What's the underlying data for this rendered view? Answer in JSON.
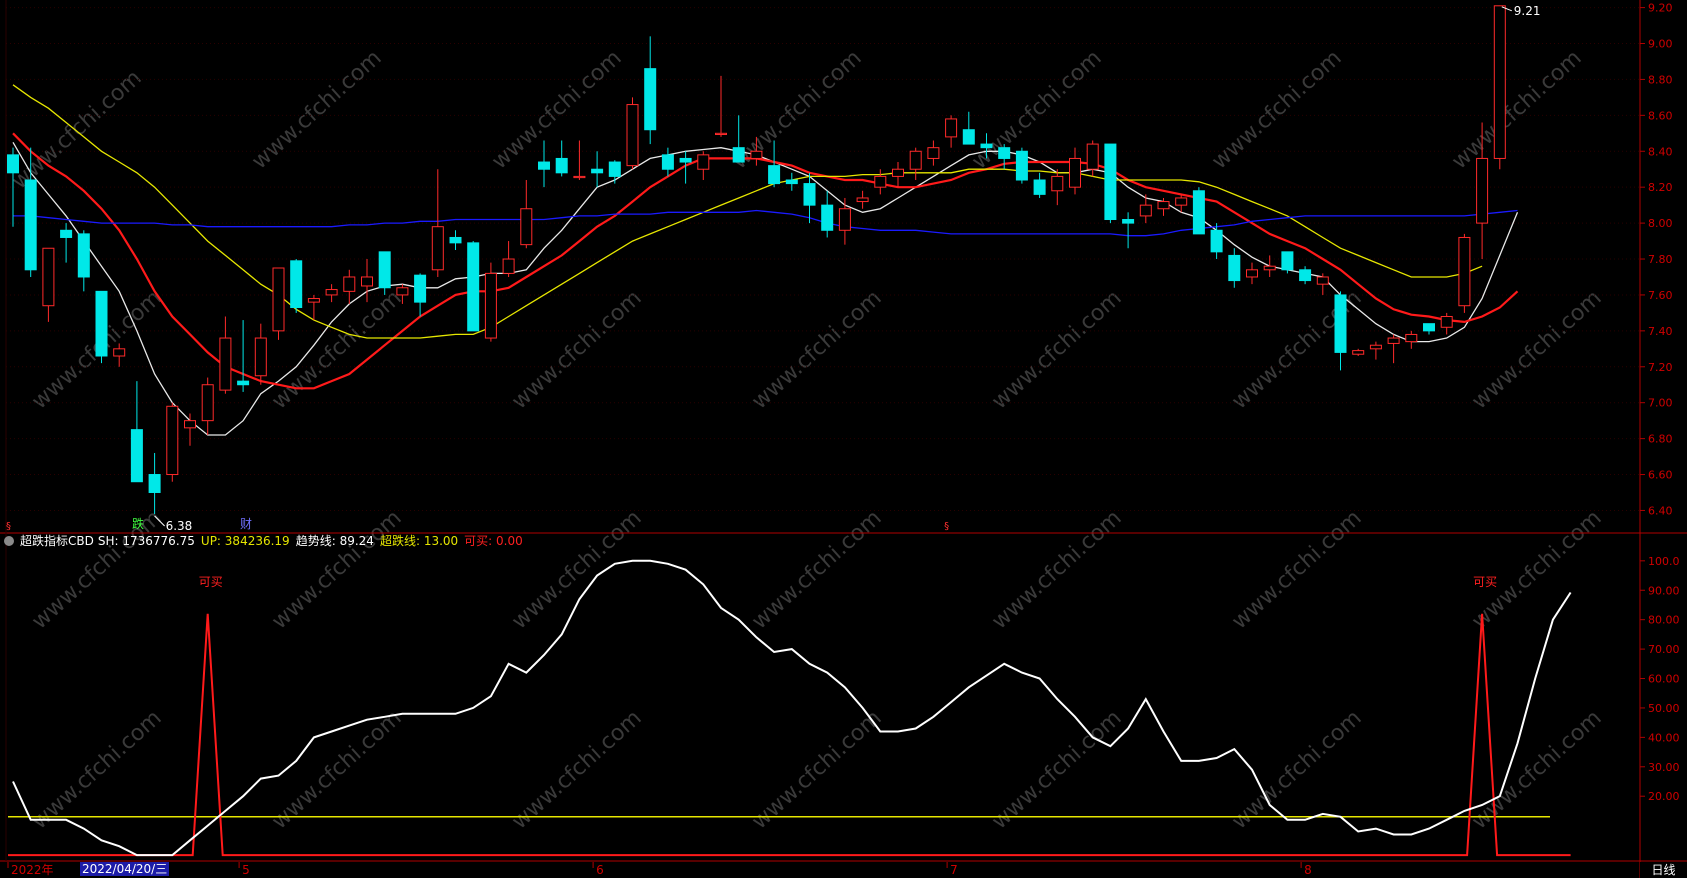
{
  "chart_data": {
    "type": "candlestick",
    "price_axis": {
      "ticks": [
        "9.20",
        "9.00",
        "8.80",
        "8.60",
        "8.40",
        "8.20",
        "8.00",
        "7.80",
        "7.60",
        "7.40",
        "7.20",
        "7.00",
        "6.80",
        "6.60",
        "6.40"
      ],
      "ylim": [
        6.28,
        9.22
      ]
    },
    "candles": [
      {
        "o": 8.38,
        "h": 8.42,
        "l": 7.98,
        "c": 8.28
      },
      {
        "o": 8.24,
        "h": 8.42,
        "l": 7.7,
        "c": 7.74
      },
      {
        "o": 7.54,
        "h": 7.86,
        "l": 7.45,
        "c": 7.86
      },
      {
        "o": 7.96,
        "h": 8.0,
        "l": 7.78,
        "c": 7.92
      },
      {
        "o": 7.94,
        "h": 7.96,
        "l": 7.62,
        "c": 7.7
      },
      {
        "o": 7.62,
        "h": 7.62,
        "l": 7.22,
        "c": 7.26
      },
      {
        "o": 7.26,
        "h": 7.33,
        "l": 7.2,
        "c": 7.3
      },
      {
        "o": 6.85,
        "h": 7.12,
        "l": 6.58,
        "c": 6.56
      },
      {
        "o": 6.6,
        "h": 6.72,
        "l": 6.38,
        "c": 6.5
      },
      {
        "o": 6.6,
        "h": 7.0,
        "l": 6.56,
        "c": 6.98
      },
      {
        "o": 6.86,
        "h": 6.94,
        "l": 6.76,
        "c": 6.9
      },
      {
        "o": 6.9,
        "h": 7.14,
        "l": 6.82,
        "c": 7.1
      },
      {
        "o": 7.07,
        "h": 7.48,
        "l": 7.05,
        "c": 7.36
      },
      {
        "o": 7.12,
        "h": 7.46,
        "l": 7.06,
        "c": 7.1
      },
      {
        "o": 7.15,
        "h": 7.44,
        "l": 7.1,
        "c": 7.36
      },
      {
        "o": 7.4,
        "h": 7.7,
        "l": 7.35,
        "c": 7.75
      },
      {
        "o": 7.79,
        "h": 7.8,
        "l": 7.5,
        "c": 7.53
      },
      {
        "o": 7.56,
        "h": 7.6,
        "l": 7.46,
        "c": 7.58
      },
      {
        "o": 7.6,
        "h": 7.66,
        "l": 7.56,
        "c": 7.63
      },
      {
        "o": 7.62,
        "h": 7.74,
        "l": 7.55,
        "c": 7.7
      },
      {
        "o": 7.65,
        "h": 7.8,
        "l": 7.56,
        "c": 7.7
      },
      {
        "o": 7.84,
        "h": 7.84,
        "l": 7.6,
        "c": 7.64
      },
      {
        "o": 7.6,
        "h": 7.66,
        "l": 7.55,
        "c": 7.64
      },
      {
        "o": 7.71,
        "h": 7.72,
        "l": 7.48,
        "c": 7.56
      },
      {
        "o": 7.74,
        "h": 8.3,
        "l": 7.7,
        "c": 7.98
      },
      {
        "o": 7.92,
        "h": 7.96,
        "l": 7.85,
        "c": 7.89
      },
      {
        "o": 7.89,
        "h": 7.9,
        "l": 7.4,
        "c": 7.4
      },
      {
        "o": 7.36,
        "h": 7.78,
        "l": 7.34,
        "c": 7.72
      },
      {
        "o": 7.72,
        "h": 7.9,
        "l": 7.7,
        "c": 7.8
      },
      {
        "o": 7.88,
        "h": 8.24,
        "l": 7.86,
        "c": 8.08
      },
      {
        "o": 8.34,
        "h": 8.46,
        "l": 8.2,
        "c": 8.3
      },
      {
        "o": 8.36,
        "h": 8.46,
        "l": 8.26,
        "c": 8.28
      },
      {
        "o": 8.26,
        "h": 8.46,
        "l": 8.24,
        "c": 8.26
      },
      {
        "o": 8.3,
        "h": 8.4,
        "l": 8.2,
        "c": 8.28
      },
      {
        "o": 8.34,
        "h": 8.35,
        "l": 8.22,
        "c": 8.26
      },
      {
        "o": 8.32,
        "h": 8.7,
        "l": 8.3,
        "c": 8.66
      },
      {
        "o": 8.86,
        "h": 9.04,
        "l": 8.44,
        "c": 8.52
      },
      {
        "o": 8.38,
        "h": 8.42,
        "l": 8.26,
        "c": 8.3
      },
      {
        "o": 8.36,
        "h": 8.4,
        "l": 8.22,
        "c": 8.34
      },
      {
        "o": 8.3,
        "h": 8.4,
        "l": 8.24,
        "c": 8.38
      },
      {
        "o": 8.5,
        "h": 8.82,
        "l": 8.48,
        "c": 8.5
      },
      {
        "o": 8.42,
        "h": 8.6,
        "l": 8.36,
        "c": 8.34
      },
      {
        "o": 8.36,
        "h": 8.48,
        "l": 8.32,
        "c": 8.4
      },
      {
        "o": 8.32,
        "h": 8.46,
        "l": 8.2,
        "c": 8.22
      },
      {
        "o": 8.24,
        "h": 8.28,
        "l": 8.18,
        "c": 8.22
      },
      {
        "o": 8.22,
        "h": 8.28,
        "l": 8.0,
        "c": 8.1
      },
      {
        "o": 8.1,
        "h": 8.18,
        "l": 7.92,
        "c": 7.96
      },
      {
        "o": 7.96,
        "h": 8.14,
        "l": 7.88,
        "c": 8.08
      },
      {
        "o": 8.12,
        "h": 8.18,
        "l": 8.08,
        "c": 8.14
      },
      {
        "o": 8.2,
        "h": 8.3,
        "l": 8.16,
        "c": 8.26
      },
      {
        "o": 8.26,
        "h": 8.34,
        "l": 8.2,
        "c": 8.3
      },
      {
        "o": 8.3,
        "h": 8.42,
        "l": 8.24,
        "c": 8.4
      },
      {
        "o": 8.36,
        "h": 8.46,
        "l": 8.32,
        "c": 8.42
      },
      {
        "o": 8.48,
        "h": 8.6,
        "l": 8.42,
        "c": 8.58
      },
      {
        "o": 8.52,
        "h": 8.62,
        "l": 8.46,
        "c": 8.44
      },
      {
        "o": 8.44,
        "h": 8.5,
        "l": 8.36,
        "c": 8.42
      },
      {
        "o": 8.42,
        "h": 8.44,
        "l": 8.3,
        "c": 8.36
      },
      {
        "o": 8.4,
        "h": 8.42,
        "l": 8.22,
        "c": 8.24
      },
      {
        "o": 8.24,
        "h": 8.28,
        "l": 8.14,
        "c": 8.16
      },
      {
        "o": 8.18,
        "h": 8.3,
        "l": 8.1,
        "c": 8.26
      },
      {
        "o": 8.2,
        "h": 8.42,
        "l": 8.16,
        "c": 8.36
      },
      {
        "o": 8.3,
        "h": 8.46,
        "l": 8.26,
        "c": 8.44
      },
      {
        "o": 8.44,
        "h": 8.44,
        "l": 8.0,
        "c": 8.02
      },
      {
        "o": 8.02,
        "h": 8.06,
        "l": 7.86,
        "c": 8.0
      },
      {
        "o": 8.04,
        "h": 8.16,
        "l": 8.0,
        "c": 8.1
      },
      {
        "o": 8.08,
        "h": 8.14,
        "l": 8.04,
        "c": 8.12
      },
      {
        "o": 8.1,
        "h": 8.16,
        "l": 8.06,
        "c": 8.14
      },
      {
        "o": 8.18,
        "h": 8.2,
        "l": 7.94,
        "c": 7.94
      },
      {
        "o": 7.96,
        "h": 8.0,
        "l": 7.8,
        "c": 7.84
      },
      {
        "o": 7.82,
        "h": 7.86,
        "l": 7.64,
        "c": 7.68
      },
      {
        "o": 7.7,
        "h": 7.78,
        "l": 7.66,
        "c": 7.74
      },
      {
        "o": 7.74,
        "h": 7.82,
        "l": 7.7,
        "c": 7.76
      },
      {
        "o": 7.84,
        "h": 7.84,
        "l": 7.72,
        "c": 7.74
      },
      {
        "o": 7.74,
        "h": 7.76,
        "l": 7.66,
        "c": 7.68
      },
      {
        "o": 7.66,
        "h": 7.72,
        "l": 7.6,
        "c": 7.7
      },
      {
        "o": 7.6,
        "h": 7.62,
        "l": 7.18,
        "c": 7.28
      },
      {
        "o": 7.27,
        "h": 7.3,
        "l": 7.26,
        "c": 7.29
      },
      {
        "o": 7.3,
        "h": 7.34,
        "l": 7.24,
        "c": 7.32
      },
      {
        "o": 7.33,
        "h": 7.38,
        "l": 7.22,
        "c": 7.36
      },
      {
        "o": 7.34,
        "h": 7.4,
        "l": 7.3,
        "c": 7.38
      },
      {
        "o": 7.44,
        "h": 7.44,
        "l": 7.38,
        "c": 7.4
      },
      {
        "o": 7.42,
        "h": 7.5,
        "l": 7.38,
        "c": 7.48
      },
      {
        "o": 7.54,
        "h": 7.94,
        "l": 7.5,
        "c": 7.92
      },
      {
        "o": 8.0,
        "h": 8.56,
        "l": 7.8,
        "c": 8.36
      },
      {
        "o": 8.36,
        "h": 9.21,
        "l": 8.3,
        "c": 9.21
      }
    ],
    "ma": [
      {
        "name": "MA5",
        "color": "#e8e8e8",
        "values": [
          8.45,
          8.28,
          8.16,
          8.04,
          7.9,
          7.76,
          7.62,
          7.4,
          7.16,
          7.0,
          6.9,
          6.82,
          6.82,
          6.9,
          7.05,
          7.12,
          7.2,
          7.32,
          7.45,
          7.55,
          7.62,
          7.65,
          7.66,
          7.64,
          7.64,
          7.69,
          7.7,
          7.72,
          7.72,
          7.74,
          7.86,
          7.96,
          8.08,
          8.2,
          8.24,
          8.3,
          8.36,
          8.38,
          8.4,
          8.41,
          8.42,
          8.4,
          8.38,
          8.34,
          8.3,
          8.26,
          8.18,
          8.1,
          8.06,
          8.08,
          8.14,
          8.2,
          8.26,
          8.32,
          8.38,
          8.4,
          8.4,
          8.38,
          8.34,
          8.28,
          8.28,
          8.3,
          8.28,
          8.2,
          8.14,
          8.12,
          8.06,
          8.03,
          7.96,
          7.88,
          7.81,
          7.76,
          7.74,
          7.72,
          7.7,
          7.6,
          7.52,
          7.44,
          7.38,
          7.34,
          7.34,
          7.36,
          7.42,
          7.58,
          7.82,
          8.06
        ]
      },
      {
        "name": "MA10",
        "color": "#ff1a1a",
        "values": [
          8.5,
          8.4,
          8.32,
          8.26,
          8.18,
          8.08,
          7.96,
          7.8,
          7.62,
          7.48,
          7.38,
          7.28,
          7.2,
          7.16,
          7.12,
          7.1,
          7.08,
          7.08,
          7.12,
          7.16,
          7.24,
          7.32,
          7.4,
          7.48,
          7.54,
          7.6,
          7.62,
          7.62,
          7.64,
          7.7,
          7.76,
          7.82,
          7.9,
          7.98,
          8.04,
          8.12,
          8.2,
          8.26,
          8.32,
          8.36,
          8.36,
          8.36,
          8.36,
          8.34,
          8.32,
          8.28,
          8.26,
          8.24,
          8.24,
          8.22,
          8.2,
          8.2,
          8.22,
          8.24,
          8.28,
          8.3,
          8.33,
          8.34,
          8.34,
          8.34,
          8.34,
          8.33,
          8.3,
          8.24,
          8.2,
          8.18,
          8.16,
          8.14,
          8.12,
          8.06,
          8.0,
          7.94,
          7.9,
          7.86,
          7.8,
          7.74,
          7.66,
          7.58,
          7.52,
          7.49,
          7.48,
          7.46,
          7.45,
          7.48,
          7.53,
          7.62
        ]
      },
      {
        "name": "MA20",
        "color": "#e6e600",
        "values": [
          8.77,
          8.7,
          8.64,
          8.56,
          8.48,
          8.4,
          8.34,
          8.28,
          8.2,
          8.1,
          8.0,
          7.9,
          7.82,
          7.74,
          7.66,
          7.6,
          7.52,
          7.46,
          7.42,
          7.38,
          7.36,
          7.36,
          7.36,
          7.36,
          7.37,
          7.38,
          7.38,
          7.42,
          7.48,
          7.54,
          7.6,
          7.66,
          7.72,
          7.78,
          7.84,
          7.9,
          7.94,
          7.98,
          8.02,
          8.06,
          8.1,
          8.14,
          8.18,
          8.22,
          8.24,
          8.26,
          8.26,
          8.26,
          8.27,
          8.27,
          8.28,
          8.28,
          8.28,
          8.28,
          8.3,
          8.3,
          8.3,
          8.29,
          8.29,
          8.28,
          8.28,
          8.26,
          8.24,
          8.24,
          8.24,
          8.24,
          8.24,
          8.23,
          8.2,
          8.16,
          8.12,
          8.08,
          8.04,
          7.98,
          7.92,
          7.86,
          7.82,
          7.78,
          7.74,
          7.7,
          7.7,
          7.7,
          7.72,
          7.76
        ]
      },
      {
        "name": "MA60",
        "color": "#1a1aff",
        "values": [
          8.04,
          8.04,
          8.03,
          8.02,
          8.01,
          8.0,
          8.0,
          8.0,
          8.0,
          7.99,
          7.99,
          7.98,
          7.98,
          7.98,
          7.98,
          7.98,
          7.98,
          7.98,
          7.98,
          7.99,
          7.99,
          8.0,
          8.0,
          8.01,
          8.01,
          8.02,
          8.02,
          8.02,
          8.02,
          8.02,
          8.02,
          8.03,
          8.04,
          8.04,
          8.05,
          8.05,
          8.05,
          8.06,
          8.06,
          8.06,
          8.06,
          8.06,
          8.07,
          8.06,
          8.05,
          8.03,
          8.0,
          7.98,
          7.97,
          7.96,
          7.96,
          7.96,
          7.95,
          7.94,
          7.94,
          7.94,
          7.94,
          7.94,
          7.94,
          7.94,
          7.94,
          7.94,
          7.94,
          7.93,
          7.93,
          7.94,
          7.96,
          7.97,
          7.98,
          7.99,
          8.01,
          8.02,
          8.03,
          8.04,
          8.04,
          8.04,
          8.04,
          8.04,
          8.04,
          8.04,
          8.04,
          8.04,
          8.04,
          8.05,
          8.06,
          8.07
        ]
      }
    ],
    "price_markers": {
      "low_label": "6.38",
      "high_label": "9.21"
    },
    "event_labels": {
      "die": "跌",
      "cai": "财"
    },
    "indicator": {
      "name": "超跌指标CBD",
      "sh_label": "SH:",
      "sh_value": "1736776.75",
      "up_label": "UP:",
      "up_value": "384236.19",
      "trend_label": "趋势线:",
      "trend_value": "89.24",
      "oversold_label": "超跌线:",
      "oversold_value": "13.00",
      "buy_label": "可买:",
      "buy_value": "0.00",
      "axis_ticks": [
        "100.0",
        "90.00",
        "80.00",
        "70.00",
        "60.00",
        "50.00",
        "40.00",
        "30.00",
        "20.00"
      ],
      "ylim": [
        -1,
        103
      ],
      "oversold_level": 13,
      "trend_values": [
        25,
        12,
        12,
        12,
        9,
        5,
        3,
        0,
        0,
        0,
        5,
        10,
        15,
        20,
        26,
        27,
        32,
        40,
        42,
        44,
        46,
        47,
        48,
        48,
        48,
        48,
        50,
        54,
        65,
        62,
        68,
        75,
        87,
        95,
        99,
        100,
        100,
        99,
        97,
        92,
        84,
        80,
        74,
        69,
        70,
        65,
        62,
        57,
        50,
        42,
        42,
        43,
        47,
        52,
        57,
        61,
        65,
        62,
        60,
        53,
        47,
        40,
        37,
        43,
        53,
        42,
        32,
        32,
        33,
        36,
        29,
        17,
        12,
        12,
        14,
        13,
        8,
        9,
        7,
        7,
        9,
        12,
        15,
        17,
        20,
        38,
        60,
        80,
        89.24
      ],
      "buy_signal": {
        "label": "可买",
        "indices": [
          11,
          83
        ],
        "high": 82
      }
    },
    "time_axis": {
      "labels": [
        "2022年",
        "5",
        "6",
        "7",
        "8"
      ],
      "cursor_date": "2022/04/20/三",
      "period": "日线"
    },
    "watermark": "www.cfchi.com"
  }
}
